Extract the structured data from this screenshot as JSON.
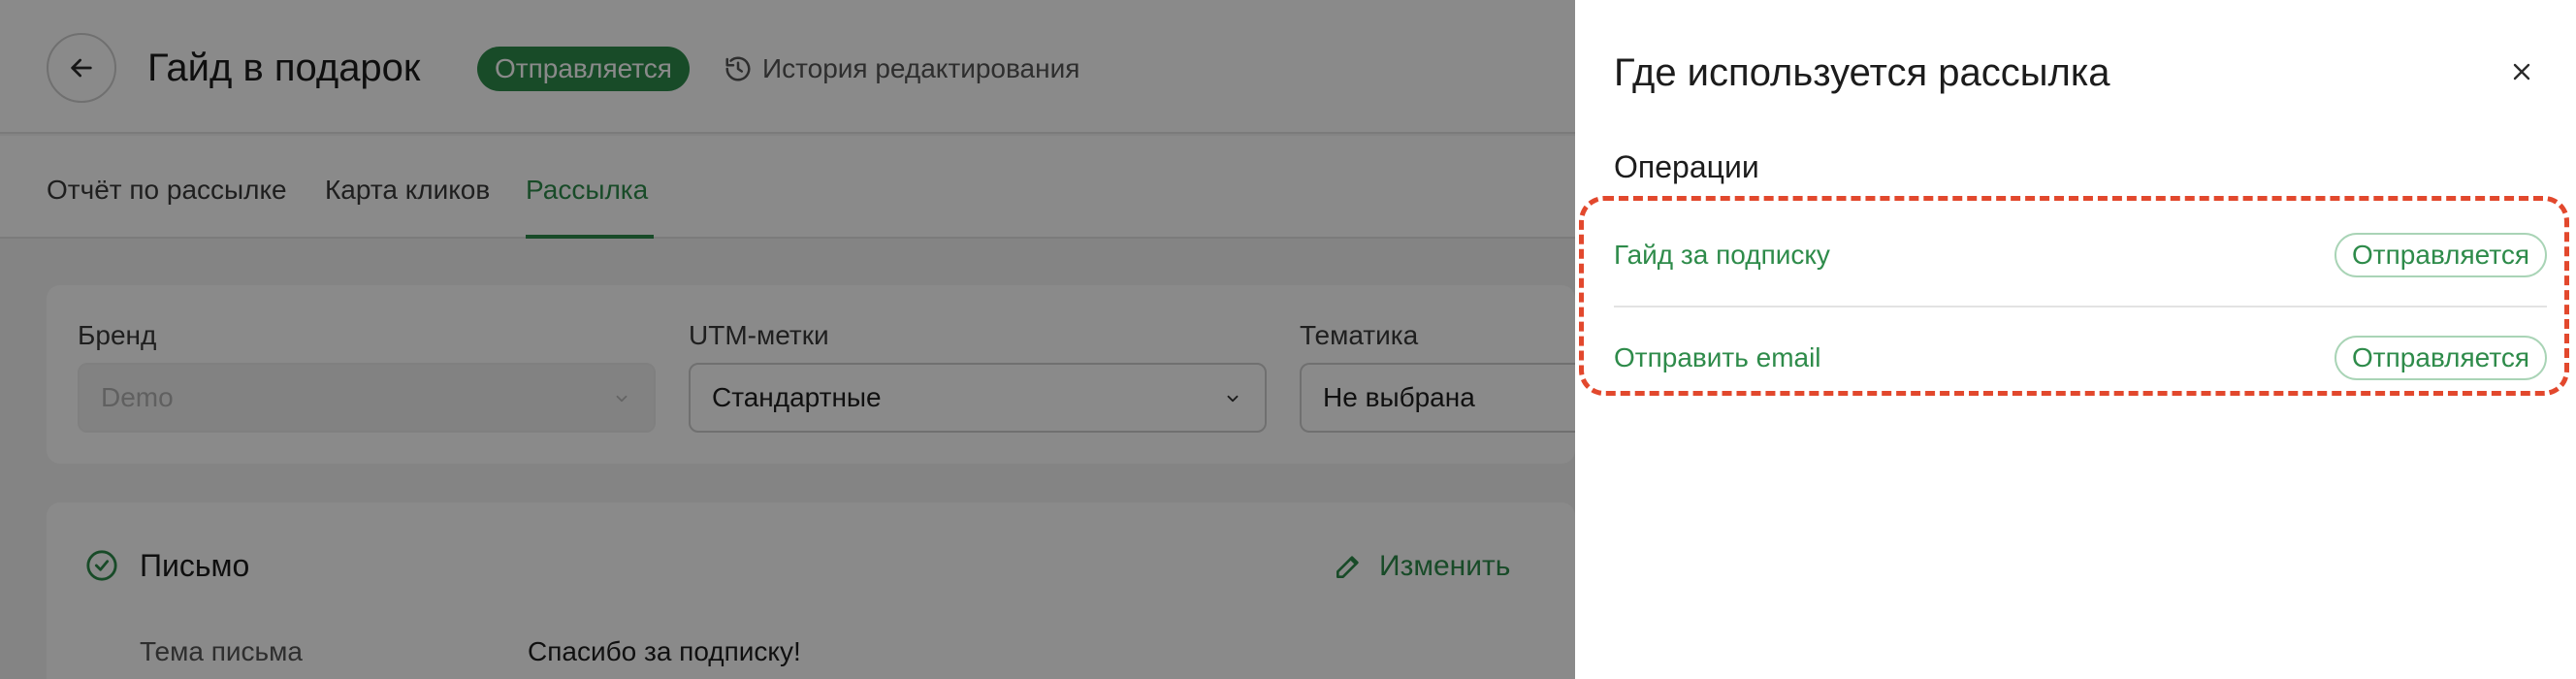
{
  "header": {
    "title": "Гайд в подарок",
    "status": "Отправляется",
    "history_label": "История редактирования"
  },
  "tabs": [
    {
      "label": "Отчёт по рассылке",
      "active": false
    },
    {
      "label": "Карта кликов",
      "active": false
    },
    {
      "label": "Рассылка",
      "active": true
    }
  ],
  "filters": {
    "brand": {
      "label": "Бренд",
      "value": "Demo"
    },
    "utm": {
      "label": "UTM-метки",
      "value": "Стандартные"
    },
    "topic": {
      "label": "Тематика",
      "value": "Не выбрана"
    }
  },
  "letter": {
    "title": "Письмо",
    "edit_label": "Изменить",
    "subject_label": "Тема письма",
    "subject_value": "Спасибо за подписку!"
  },
  "drawer": {
    "title": "Где используется рассылка",
    "section_title": "Операции",
    "operations": [
      {
        "name": "Гайд за подписку",
        "status": "Отправляется"
      },
      {
        "name": "Отправить email",
        "status": "Отправляется"
      }
    ]
  },
  "colors": {
    "accent": "#2e8b4a",
    "highlight": "#e2482d"
  }
}
